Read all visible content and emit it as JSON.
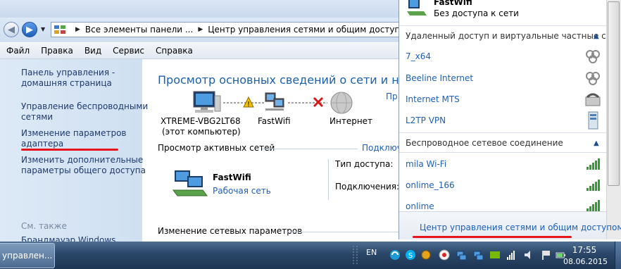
{
  "address_bar": {
    "crumbs": [
      "Все элементы панели ...",
      "Центр управления сетями и общим доступом"
    ]
  },
  "menu": [
    "Файл",
    "Правка",
    "Вид",
    "Сервис",
    "Справка"
  ],
  "sidebar": {
    "links": [
      "Панель управления -\nдомашняя страница",
      "Управление беспроводными\nсетями",
      "Изменение параметров\nадаптера",
      "Изменить дополнительные\nпараметры общего доступа"
    ],
    "see_also": "См. также",
    "firewall": "Брандмауэр Windows"
  },
  "main": {
    "title": "Просмотр основных сведений о сети и настройка подключений",
    "properties_link": "Пр",
    "map": {
      "computer_name": "XTREME-VBG2LT68",
      "computer_sub": "(этот компьютер)",
      "network_name": "FastWifi",
      "internet": "Интернет"
    },
    "active_networks_title": "Просмотр активных сетей",
    "connect_link": "Подключ",
    "network": {
      "name": "FastWifi",
      "type": "Рабочая сеть"
    },
    "access_type_label": "Тип доступа:",
    "connections_label": "Подключения:",
    "change_settings_title": "Изменение сетевых параметров"
  },
  "popup": {
    "current_network": "FastWifi",
    "current_status": "Без доступа к сети",
    "dialup_section": "Удаленный доступ и виртуальные частные сети",
    "dialup_items": [
      "7_x64",
      "Beeline Internet",
      "Internet MTS",
      "L2TP VPN"
    ],
    "wireless_section": "Беспроводное сетевое соединение",
    "wireless_items": [
      "mila Wi-Fi",
      "onlime_166",
      "onlime"
    ],
    "footer_link": "Центр управления сетями и общим доступом"
  },
  "taskbar": {
    "task_button": "управлен...",
    "language": "EN",
    "time": "17:55",
    "date": "08.06.2015"
  },
  "colors": {
    "link": "#1e5fb8",
    "title": "#1d5fa9",
    "highlight_underline": "#e8141b",
    "signal": "#2e9e2e"
  }
}
